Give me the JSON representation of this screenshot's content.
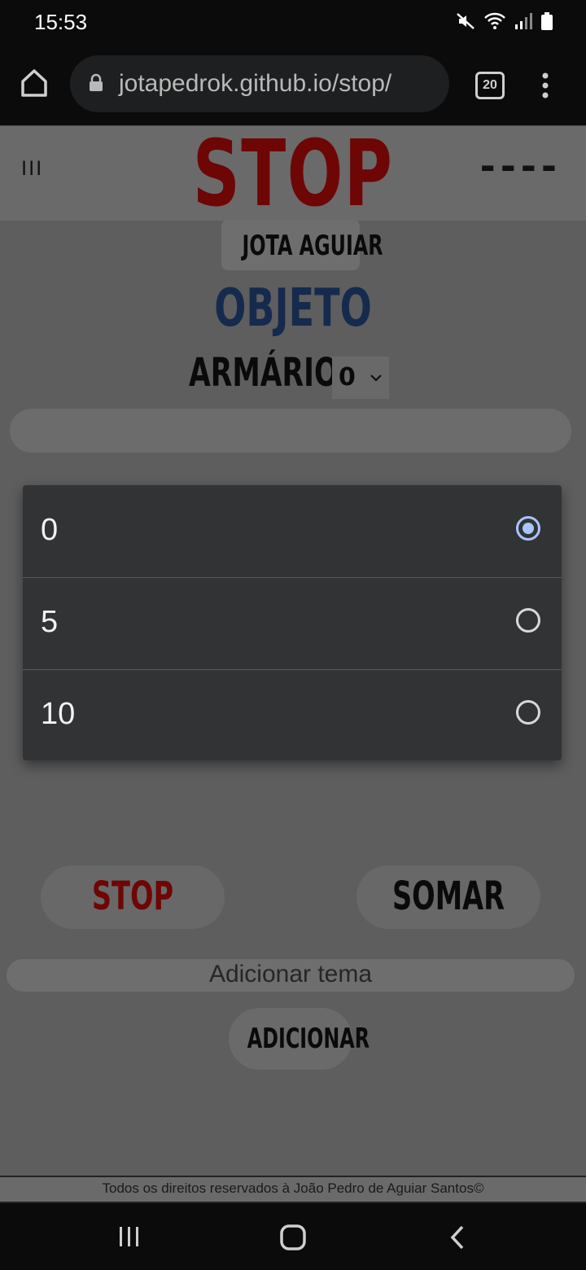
{
  "status_bar": {
    "time": "15:53",
    "icons": [
      "mute-icon",
      "wifi-icon",
      "signal-icon",
      "battery-icon"
    ]
  },
  "browser": {
    "url": "jotapedrok.github.io/stop/",
    "tab_count": "20",
    "icons": [
      "home-icon",
      "lock-icon",
      "tabs-icon",
      "more-vert-icon"
    ]
  },
  "header": {
    "menu_label": "III",
    "title": "STOP",
    "timer": "----"
  },
  "game": {
    "player_name": "JOTA AGUIAR",
    "category": "OBJETO",
    "letter_word": "ARMÁRIO",
    "points_selected": "0",
    "answer_value": ""
  },
  "dropdown": {
    "options": [
      {
        "label": "0",
        "selected": true
      },
      {
        "label": "5",
        "selected": false
      },
      {
        "label": "10",
        "selected": false
      }
    ]
  },
  "buttons": {
    "stop_label": "STOP",
    "sum_label": "SOMAR",
    "add_label": "ADICIONAR"
  },
  "theme_input": {
    "placeholder": "Adicionar tema"
  },
  "footer": {
    "text": "Todos os direitos reservados à João Pedro de Aguiar Santos©"
  },
  "colors": {
    "stop_red": "#6e0606",
    "category_blue": "#152a4d",
    "page_bg": "#5e5e5e",
    "dropdown_bg": "#323335",
    "radio_selected": "#a9c4ff"
  }
}
